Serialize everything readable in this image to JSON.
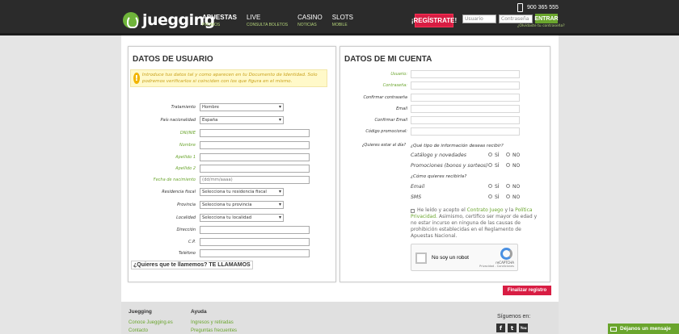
{
  "header": {
    "logo_text": "juegging",
    "phone": "900 365 555",
    "nav": [
      {
        "main": "APUESTAS",
        "sub": "PROMOS"
      },
      {
        "main": "LIVE",
        "sub": "CONSULTA BOLETOS"
      },
      {
        "main": "CASINO",
        "sub": "NOTICIAS"
      },
      {
        "main": "SLOTS",
        "sub": "MOBILE"
      }
    ],
    "register_label": "¡REGÍSTRATE!",
    "user_placeholder": "Usuario",
    "password_placeholder": "Contraseña",
    "enter_label": "ENTRAR",
    "forgot": "¿Olvidaste tu contraseña?"
  },
  "user_section": {
    "title": "DATOS DE USUARIO",
    "warning": "Introduce tus datos tal y como aparecen en tu Documento de Identidad. Solo podremos verificarlos si coinciden con los que figura en el mismo.",
    "fields": [
      {
        "label": "Tratamiento",
        "value": "Hombre",
        "type": "select"
      },
      {
        "label": "País nacionalidad",
        "value": "España",
        "type": "select"
      },
      {
        "label": "DNI/NIE",
        "value": "",
        "type": "text"
      },
      {
        "label": "Nombre",
        "value": "",
        "type": "text"
      },
      {
        "label": "Apellido 1",
        "value": "",
        "type": "text"
      },
      {
        "label": "Apellido 2",
        "value": "",
        "type": "text"
      },
      {
        "label": "Fecha de nacimiento",
        "value": "(dd/mm/aaaa)",
        "type": "text"
      },
      {
        "label": "Residencia fiscal",
        "value": "Selecciona tu residencia fiscal",
        "type": "select"
      },
      {
        "label": "Provincia",
        "value": "Selecciona tu provincia",
        "type": "select"
      },
      {
        "label": "Localidad",
        "value": "Selecciona tu localidad",
        "type": "select"
      },
      {
        "label": "Dirección",
        "value": "",
        "type": "text"
      },
      {
        "label": "C.P.",
        "value": "",
        "type": "text"
      },
      {
        "label": "Teléfono",
        "value": "",
        "type": "text"
      }
    ],
    "callme": "¿Quieres que te llamemos? TE LLAMAMOS"
  },
  "account_section": {
    "title": "DATOS DE MI CUENTA",
    "fields": [
      {
        "label": "Usuario:"
      },
      {
        "label": "Contraseña:"
      },
      {
        "label": "Confirmar contraseña"
      },
      {
        "label": "Email"
      },
      {
        "label": "Confirmar Email"
      },
      {
        "label": "Código promocional:"
      }
    ],
    "day_label": "¿Quieres estar al día?",
    "info_question": "¿Qué tipo de información deseas recibir?",
    "info_options": [
      "Catálogo y novedades",
      "Promociones (bonos y sorteos)"
    ],
    "how_question": "¿Cómo quieres recibirla?",
    "how_options": [
      "Email",
      "SMS"
    ],
    "yes": "SÍ",
    "no": "NO",
    "legal_prefix": "He leído y acepto el",
    "legal_link1": "Contrato Juego",
    "legal_and": "y la",
    "legal_link2": "Política Privacidad.",
    "legal_body": "Asimismo, certifico ser mayor de edad y no estar incurso en ninguna de las causas de prohibición establecidas en el Reglamento de Apuestas Nacional.",
    "captcha_text": "No soy un robot",
    "captcha_brand": "reCAPTCHA",
    "captcha_small": "Privacidad - Condiciones",
    "finish_label": "Finalizar registro"
  },
  "footer": {
    "col1_title": "Juegging",
    "col1_links": [
      "Conoce Juegging.es",
      "Contacto"
    ],
    "col2_title": "Ayuda",
    "col2_links": [
      "Ingresos y retiradas",
      "Preguntas frecuentes"
    ],
    "follow": "Síguenos en:",
    "social": [
      "f",
      "t",
      "You"
    ],
    "message_button": "Déjanos un mensaje"
  }
}
